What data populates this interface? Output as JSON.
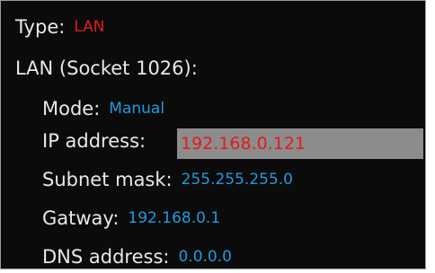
{
  "type": {
    "label": "Type:",
    "value": "LAN"
  },
  "lan_header": "LAN (Socket 1026):",
  "mode": {
    "label": "Mode:",
    "value": "Manual"
  },
  "ip": {
    "label": "IP address:",
    "value": "192.168.0.121"
  },
  "subnet": {
    "label": "Subnet mask:",
    "value": "255.255.255.0"
  },
  "gateway": {
    "label": "Gatway:",
    "value": "192.168.0.1"
  },
  "dns": {
    "label": "DNS address:",
    "value": "0.0.0.0"
  },
  "colors": {
    "background": "#0b0b0b",
    "label_text": "#e8e8e8",
    "value_red": "#e01c1c",
    "value_blue": "#1f9be0",
    "selected_field": "#8c8c8c"
  }
}
